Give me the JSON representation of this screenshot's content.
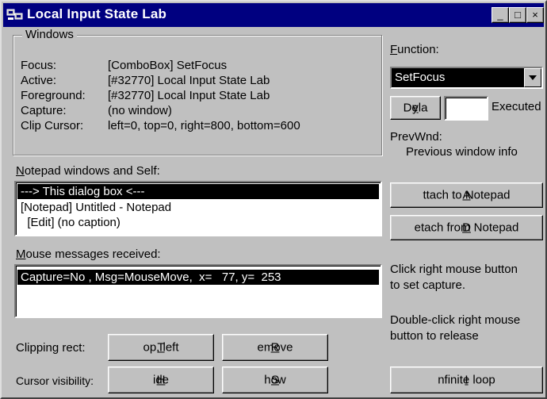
{
  "window": {
    "title": "Local Input State Lab",
    "controls": {
      "minimize": "_",
      "maximize": "□",
      "close": "×"
    }
  },
  "windows_group": {
    "title": "Windows",
    "rows": [
      {
        "label": "Focus:",
        "value": "[ComboBox] SetFocus"
      },
      {
        "label": "Active:",
        "value": "[#32770] Local Input State Lab"
      },
      {
        "label": "Foreground:",
        "value": "[#32770] Local Input State Lab"
      },
      {
        "label": "Capture:",
        "value": "(no window)"
      },
      {
        "label": "Clip Cursor:",
        "value": "left=0, top=0, right=800, bottom=600"
      }
    ]
  },
  "function": {
    "label_prefix": "",
    "label_u": "F",
    "label_rest": "unction:",
    "selected": "SetFocus"
  },
  "delay": {
    "button_u": "y",
    "button_pre": "Dela",
    "button_post": ":",
    "input_value": "",
    "status": "Executed"
  },
  "prev_wnd": {
    "label": "PrevWnd:",
    "value": "Previous window info"
  },
  "notepad": {
    "label_u": "N",
    "label_rest": "otepad windows and Self:",
    "items": [
      "---> This dialog box <---",
      "[Notepad] Untitled - Notepad",
      "  [Edit] (no caption)"
    ]
  },
  "mouse": {
    "label_u": "M",
    "label_rest": "ouse messages received:",
    "items": [
      "Capture=No , Msg=MouseMove,  x=   77, y=  253"
    ]
  },
  "buttons": {
    "attach": {
      "u": "A",
      "rest": "ttach to Notepad"
    },
    "detach": {
      "u": "D",
      "rest": "etach from Notepad"
    },
    "top_left": {
      "u": "T",
      "rest": "op, left"
    },
    "remove": {
      "u": "R",
      "rest": "emove"
    },
    "hide": {
      "u": "H",
      "rest": "ide"
    },
    "show": {
      "u": "S",
      "rest": "how"
    },
    "infinite": {
      "u": "I",
      "rest": "nfinite loop"
    }
  },
  "hints": {
    "capture_1": "Click right mouse button",
    "capture_2": "to set capture.",
    "release_1": "Double-click right mouse",
    "release_2": "button to release"
  },
  "labels": {
    "clipping_rect": "Clipping rect:",
    "cursor_visibility": "Cursor visibility:"
  }
}
